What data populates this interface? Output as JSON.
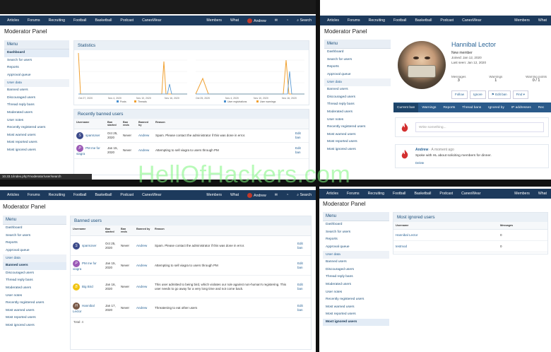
{
  "watermark": "HellOfHackers.com",
  "nav": {
    "items": [
      "Articles",
      "Forums",
      "Recruiting",
      "Football",
      "Basketball",
      "Podcast",
      "CanesWear",
      "Members",
      "What"
    ],
    "user": "Andrew",
    "search": "Search"
  },
  "title": "Moderator Panel",
  "menu": {
    "header": "Menu",
    "items": [
      "Dashboard",
      "Search for users",
      "Reports",
      "Approval queue"
    ],
    "user_header": "User data",
    "user_items": [
      "Banned users",
      "Discouraged users",
      "Thread reply bans",
      "Moderated users",
      "User notes",
      "Recently registered users",
      "Most warned users",
      "Most reported users",
      "Most ignored users"
    ]
  },
  "statistics": {
    "title": "Statistics",
    "chart1": {
      "legend": [
        "Posts",
        "Threads"
      ],
      "dates": [
        "Oct 27, 2020",
        "Nov 4, 2020",
        "Nov 10, 2020",
        "Nov 16, 2020"
      ]
    },
    "chart2": {
      "legend": [
        "User registrations",
        "User warnings"
      ],
      "dates": [
        "Oct 25, 2020",
        "Nov 4, 2020",
        "Nov 10, 2020",
        "Nov 16, 2020"
      ]
    }
  },
  "banned": {
    "title_recent": "Recently banned users",
    "title_full": "Banned users",
    "headers": [
      "Username",
      "Ban started",
      "Ban ends",
      "Banned by",
      "Reason",
      ""
    ],
    "rows": [
      {
        "user": "spamUser",
        "started": "Oct 25, 2020",
        "ends": "Never",
        "by": "Andrew",
        "reason": "Spam. Please contact the administrator if this was done in error.",
        "action": "Edit ban"
      },
      {
        "user": "PM me for viagra",
        "started": "Jan 15, 2020",
        "ends": "Never",
        "by": "Andrew",
        "reason": "Attempting to sell viagra to users through PM",
        "action": "Edit ban"
      },
      {
        "user": "Big Bird",
        "started": "Jan 16, 2020",
        "ends": "Never",
        "by": "Andrew",
        "reason": "This user admitted to being bird, which violates our rule against non-human's registering. This user needs to go away for a very long time and not come back.",
        "action": "Edit ban"
      },
      {
        "user": "Hannibal Lector",
        "started": "Jan 17, 2020",
        "ends": "Never",
        "by": "Andrew",
        "reason": "Threatening to eat other users",
        "action": "Edit ban"
      }
    ],
    "total": "Total: 4"
  },
  "statusbar": "10.33.1/index.php?moderator/user/search",
  "profile": {
    "name": "Hannibal Lector",
    "role": "New member",
    "joined": "Joined: Jan 12, 2020",
    "last_seen": "Last seen: Jan 12, 2020",
    "stats": [
      {
        "label": "Messages",
        "value": "3"
      },
      {
        "label": "Warnings",
        "value": "1"
      },
      {
        "label": "Warning points",
        "value": "0 / 1"
      }
    ],
    "buttons": [
      "Follow",
      "Ignore",
      "Edit ban",
      "Find"
    ],
    "tabs": [
      "Current ban",
      "Warnings",
      "Reports",
      "Thread bans",
      "Ignored by",
      "IP addresses",
      "Rec"
    ],
    "write_placeholder": "Write something...",
    "post_author": "Andrew",
    "post_time": "· A moment ago",
    "post_text": "Spoke with HL about soliciting members for dinner.",
    "post_delete": "Delete"
  },
  "ignored": {
    "title": "Most ignored users",
    "headers": [
      "Username",
      "Messages"
    ],
    "rows": [
      {
        "user": "Hannibal Lector",
        "count": "0"
      },
      {
        "user": "testmod",
        "count": "0"
      }
    ]
  }
}
